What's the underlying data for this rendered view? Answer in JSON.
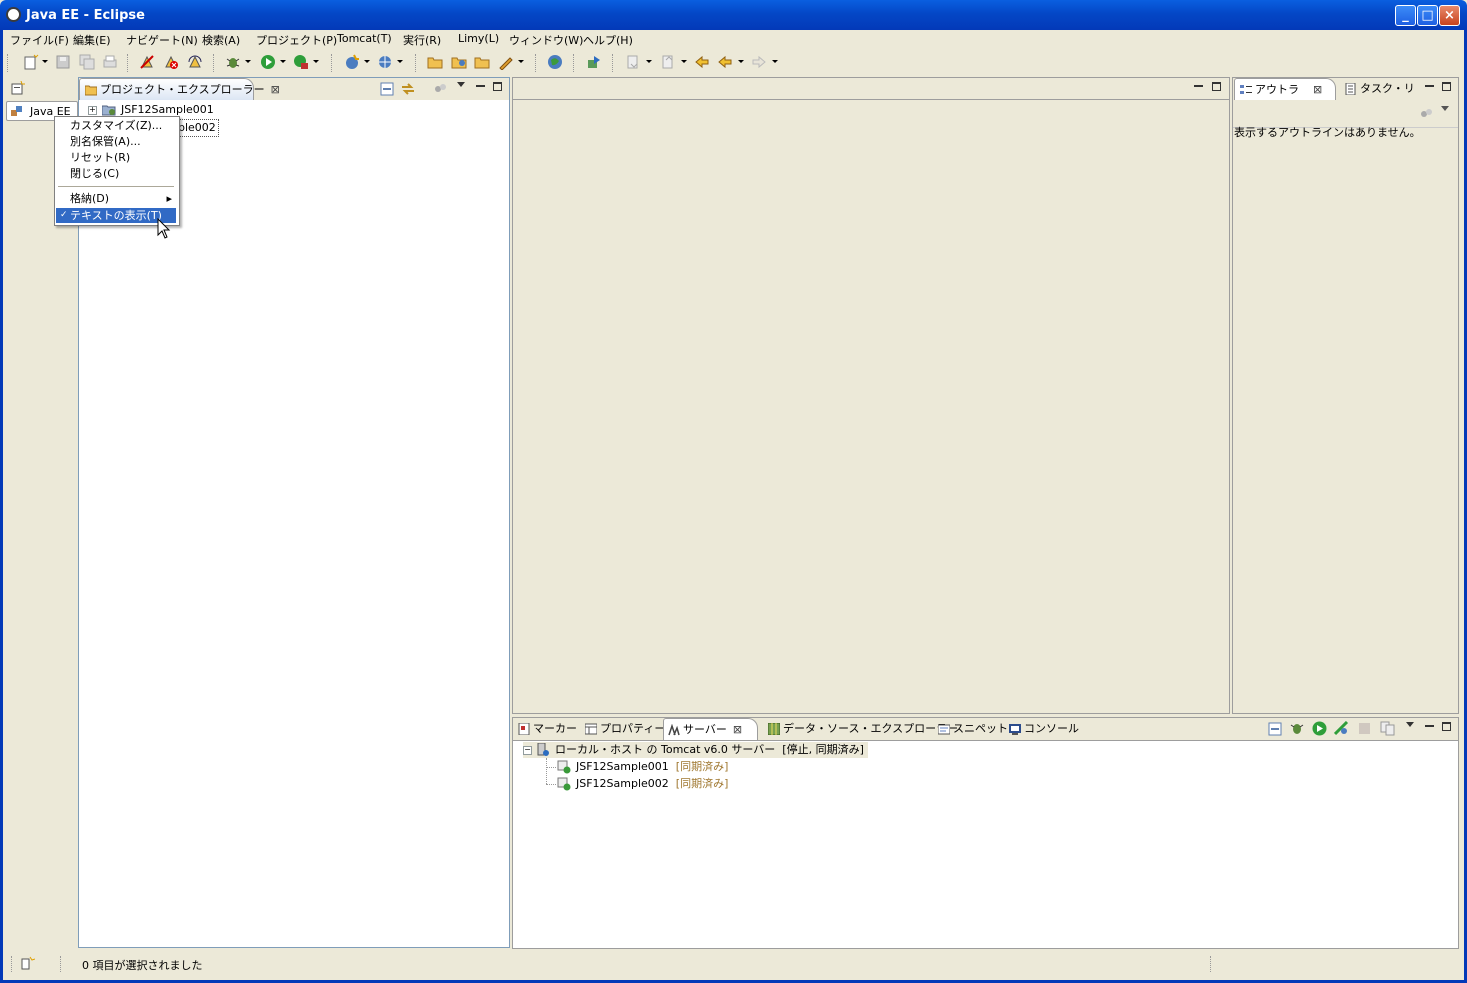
{
  "window": {
    "title": "Java EE - Eclipse",
    "minimize_glyph": "_",
    "maximize_glyph": "□",
    "close_glyph": "×"
  },
  "menu": [
    "ファイル(F)",
    "編集(E)",
    "ナビゲート(N)",
    "検索(A)",
    "プロジェクト(P)",
    "Tomcat(T)",
    "実行(R)",
    "Limy(L)",
    "ウィンドウ(W)",
    "ヘルプ(H)"
  ],
  "perspective": {
    "label": "Java EE"
  },
  "context_menu": {
    "items": [
      "カスタマイズ(Z)...",
      "別名保管(A)...",
      "リセット(R)",
      "閉じる(C)"
    ],
    "dock": "格納(D)",
    "show_text": "テキストの表示(T)",
    "check_glyph": "✓",
    "submenu_glyph": "▸"
  },
  "project_explorer": {
    "tab_label": "プロジェクト・エクスプローラー",
    "projects": [
      "JSF12Sample001",
      "JSF12Sample002"
    ],
    "second_visible_fragment": "ple002",
    "expander_glyph": "+"
  },
  "outline": {
    "tab_label": "アウトラ",
    "tasks_tab_label": "タスク・リ",
    "empty_message": "表示するアウトラインはありません。"
  },
  "bottom_tabs": {
    "markers": "マーカー",
    "properties": "プロパティー",
    "servers": "サーバー",
    "datasource": "データ・ソース・エクスプローラー",
    "snippets": "スニペット",
    "console": "コンソール"
  },
  "servers": {
    "server_label": "ローカル・ホスト の Tomcat v6.0 サーバー",
    "server_state": "[停止, 同期済み]",
    "collapse_glyph": "−",
    "modules": [
      {
        "name": "JSF12Sample001",
        "state": "[同期済み]"
      },
      {
        "name": "JSF12Sample002",
        "state": "[同期済み]"
      }
    ]
  },
  "status": {
    "text": "0 項目が選択されました"
  },
  "close_glyph": "⊠",
  "colors": {
    "title_bar": "#0447C6",
    "chrome": "#ECE9D8",
    "selection": "#316AC5",
    "sync_text": "#A07830"
  }
}
